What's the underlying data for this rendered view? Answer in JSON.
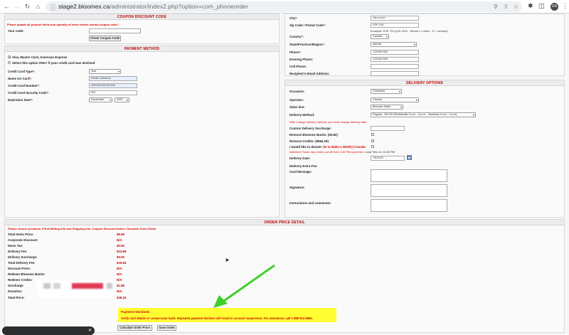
{
  "browser": {
    "site_icon": "site-info-icon",
    "url_host": "stage2.bloomex.ca",
    "url_path": "/administrator/index2.php?option=com_phoneorder",
    "avatar": "GN"
  },
  "coupon": {
    "title": "COUPON DISCOUNT CODE",
    "notice": "Please update all product items and quantity of order before submit coupon code !",
    "code_label": "Your code:",
    "button": "Check Coupon Code"
  },
  "payment": {
    "title": "PAYMENT METHOD",
    "option1": "Visa, Master Card, American Express",
    "option2": "Select this option ONLY if your credit card was declined",
    "fields": [
      {
        "label": "Credit Card Type",
        "value": "Visa"
      },
      {
        "label": "Name On Card",
        "value": "Dimitri Lukmuna"
      },
      {
        "label": "Credit Card Number",
        "value": "4000041004167406"
      },
      {
        "label": "Credit Card Security Code",
        "value": "393"
      },
      {
        "label": "Expiration Date",
        "month": "September",
        "year": "2025"
      }
    ]
  },
  "shipping": {
    "city_label": "City",
    "city": "Vancouver",
    "zip_label": "Zip Code / Postal Code",
    "zip": "V6H 1A6",
    "zip_example": "Example: K2E 7X3 (LDL DLD , Where L= letter , D = number)",
    "country_label": "Country",
    "country": "Canada",
    "state_label": "State/Province/Region",
    "state": "Alberta",
    "phone_label": "Phone",
    "phone": "1234567890",
    "evening_label": "Evening Phone:",
    "evening": "1234567890",
    "cell_label": "Cell Phone:",
    "email_label": "Recipient's Email Address:"
  },
  "delivery": {
    "title": "DELIVERY OPTIONS",
    "occasion_label": "Occasion:",
    "occasion": "Christmas",
    "operator_label": "Operator:",
    "operator": "Choose",
    "sales_label": "Sales line:",
    "sales": "Bloomex Sales",
    "method_label": "Delivery Method:",
    "method": "Regular - $14.99 (Residential 9 a.m. - 8 p.m. - Business 9 a.m - 5 p.m)",
    "method_note": "After change delivery method, you must change delivery date",
    "surcharge_label": "Custom Delivery Surcharge:",
    "bucks_label": "Remove Bloomex Bucks: ($0.82)",
    "credits_label": "Remove Credits: (6984.39)",
    "donate_label": "I would like to donate:",
    "donate_amount": "$2",
    "donate_to": "to Make a Wish(r) Canada",
    "cutoff": "Attention! Same day orders cut off time 1:00 PM local time.",
    "local_time": "Local Time is: 12:50 PM",
    "date_label": "Delivery Date:",
    "date": "7/8/2025",
    "extra_label": "Delivery Extra Fee:",
    "card_label": "Card Message:",
    "sig_label": "Signature:",
    "instr_label": "Instructions and comments:"
  },
  "order": {
    "title": "ORDER PRICE DETAIL",
    "notice": "Please choose products, Fill all Billing Info and Shipping Info, Coupon Discount before Calculate Order Detail",
    "rows": [
      {
        "label": "Total Items Price:",
        "value": "$9.99"
      },
      {
        "label": "Corporate Discount:",
        "value": "N/A"
      },
      {
        "label": "Items Tax:",
        "value": "$0.50"
      },
      {
        "label": "Delivery Fee:",
        "value": "$14.99"
      },
      {
        "label": "Delivery Surcharge:",
        "value": "$0.00"
      },
      {
        "label": "Total Delivery Fee:",
        "value": "$15.84"
      },
      {
        "label": "Discount Price:",
        "value": "N/A"
      },
      {
        "label": "Redeem Bloomex Bucks:",
        "value": "N/A"
      },
      {
        "label": "Redeem Credits:",
        "value": "N/A"
      },
      {
        "label": "Surcharge",
        "value": "$1.89"
      },
      {
        "label": "Donation:",
        "value": "N/A"
      },
      {
        "label": "Total Price:",
        "value": "$28.33"
      }
    ],
    "declined_title": "Payment Declined.",
    "declined_msg": "Verify card details or contact your bank. Repeated payment declines will result in account suspension. For assistance, call 1-888-912-5666.",
    "calc_button": "Calculate Order Price",
    "save_button": "Save Order"
  },
  "colors": {
    "accent_red": "#cc0000",
    "warning_yellow": "#ffff33",
    "arrow_green": "#3fcf2a"
  }
}
